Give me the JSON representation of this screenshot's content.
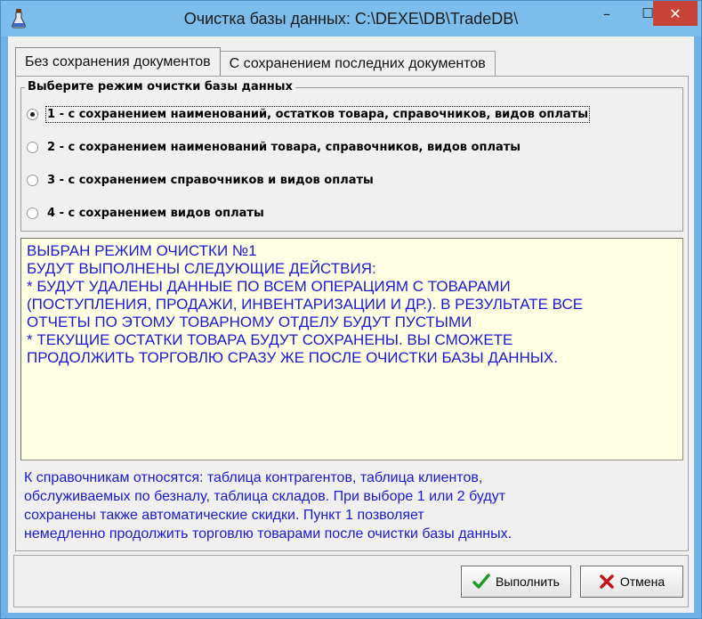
{
  "window": {
    "title": "Очистка базы данных: C:\\DEXE\\DB\\TradeDB\\",
    "minimize_glyph": "–",
    "maximize_glyph": "☐",
    "close_glyph": "✕",
    "accent_close": "#c84438"
  },
  "tabs": [
    {
      "label": "Без сохранения документов",
      "active": true
    },
    {
      "label": "С сохранением последних документов",
      "active": false
    }
  ],
  "mode_group": {
    "legend": "Выберите режим очистки базы данных",
    "options": [
      {
        "label": "1 - с сохранением наименований, остатков товара, справочников, видов оплаты",
        "selected": true
      },
      {
        "label": "2 - с сохранением наименований товара, справочников, видов оплаты",
        "selected": false
      },
      {
        "label": "3 - с сохранением справочников и видов оплаты",
        "selected": false
      },
      {
        "label": "4 - с сохранением видов оплаты",
        "selected": false
      }
    ]
  },
  "memo": {
    "lines": [
      "ВЫБРАН РЕЖИМ ОЧИСТКИ №1",
      "БУДУТ ВЫПОЛНЕНЫ СЛЕДУЮЩИЕ ДЕЙСТВИЯ:",
      "* БУДУТ УДАЛЕНЫ ДАННЫЕ ПО ВСЕМ ОПЕРАЦИЯМ С ТОВАРАМИ",
      "(ПОСТУПЛЕНИЯ, ПРОДАЖИ, ИНВЕНТАРИЗАЦИИ И ДР.). В РЕЗУЛЬТАТЕ ВСЕ",
      "ОТЧЕТЫ ПО ЭТОМУ ТОВАРНОМУ ОТДЕЛУ БУДУТ ПУСТЫМИ",
      "* ТЕКУЩИЕ ОСТАТКИ ТОВАРА БУДУТ СОХРАНЕНЫ. ВЫ СМОЖЕТЕ",
      "ПРОДОЛЖИТЬ ТОРГОВЛЮ СРАЗУ ЖЕ ПОСЛЕ ОЧИСТКИ БАЗЫ ДАННЫХ."
    ],
    "text_color": "#1a1ad6",
    "background": "#ffffe3"
  },
  "note": {
    "lines": [
      "К справочникам относятся: таблица контрагентов, таблица клиентов,",
      "обслуживаемых по безналу, таблица складов. При выборе 1 или 2 будут",
      "сохранены также автоматические скидки. Пункт 1 позволяет",
      "немедленно продолжить торговлю товарами после очистки базы данных."
    ]
  },
  "buttons": {
    "ok_label": "Выполнить",
    "ok_icon": "checkmark-icon",
    "cancel_label": "Отмена",
    "cancel_icon": "cross-icon"
  }
}
